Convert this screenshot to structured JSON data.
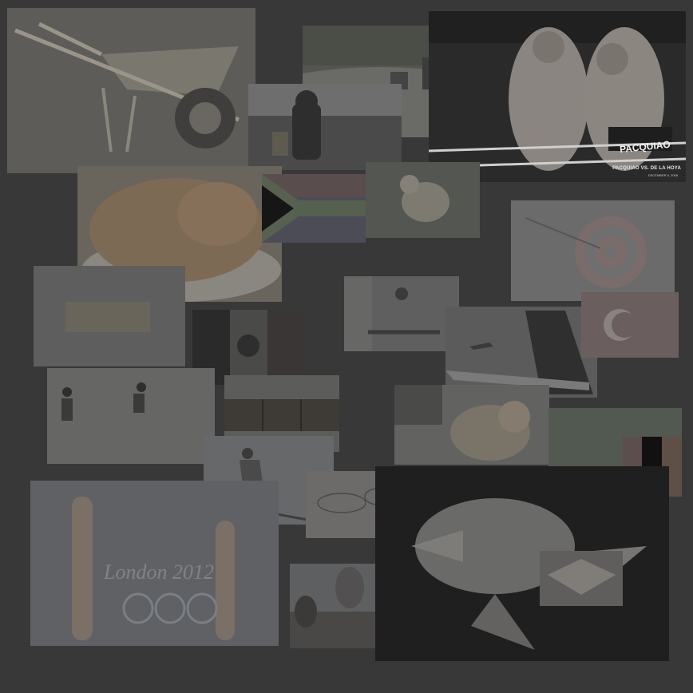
{
  "boxing": {
    "trunk_text": "PACQUIAO",
    "banner_title": "PACQUIAO VS. DE LA HOYA",
    "banner_date": "DECEMBER 6, 2008"
  },
  "olympics": {
    "text": "London 2012"
  }
}
